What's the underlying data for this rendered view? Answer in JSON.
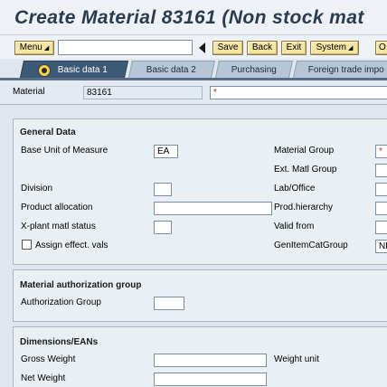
{
  "window": {
    "title": "Create Material 83161 (Non stock mat"
  },
  "toolbar": {
    "menu_label": "Menu",
    "command_value": "",
    "save_label": "Save",
    "back_label": "Back",
    "exit_label": "Exit",
    "system_label": "System",
    "overflow_label": "O"
  },
  "tabs": [
    {
      "label": "Basic data 1",
      "active": true
    },
    {
      "label": "Basic data 2",
      "active": false
    },
    {
      "label": "Purchasing",
      "active": false
    },
    {
      "label": "Foreign trade impo",
      "active": false
    }
  ],
  "header": {
    "material_label": "Material",
    "material_value": "83161",
    "description_value": "*"
  },
  "general": {
    "title": "General Data",
    "base_uom_label": "Base Unit of Measure",
    "base_uom_value": "EA",
    "division_label": "Division",
    "division_value": "",
    "product_allocation_label": "Product allocation",
    "product_allocation_value": "",
    "xplant_label": "X-plant matl status",
    "xplant_value": "",
    "assign_effect_label": "Assign effect. vals",
    "assign_effect_checked": false,
    "material_group_label": "Material Group",
    "material_group_value": "*",
    "ext_matl_group_label": "Ext. Matl Group",
    "ext_matl_group_value": "",
    "lab_office_label": "Lab/Office",
    "lab_office_value": "",
    "prod_hierarchy_label": "Prod.hierarchy",
    "prod_hierarchy_value": "",
    "valid_from_label": "Valid from",
    "valid_from_value": "",
    "gen_item_cat_label": "GenItemCatGroup",
    "gen_item_cat_value": "NL"
  },
  "auth": {
    "title": "Material authorization group",
    "auth_group_label": "Authorization Group",
    "auth_group_value": ""
  },
  "dimensions": {
    "title": "Dimensions/EANs",
    "gross_weight_label": "Gross Weight",
    "gross_weight_value": "",
    "weight_unit_label": "Weight unit",
    "net_weight_label": "Net Weight",
    "net_weight_value": ""
  }
}
